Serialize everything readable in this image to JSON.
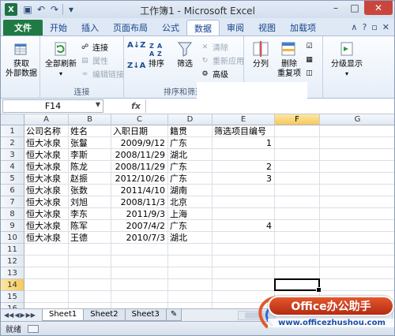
{
  "window": {
    "app_icon": "X",
    "title": "工作簿1 - Microsoft Excel",
    "min": "–",
    "max": "□",
    "close": "✕",
    "qat": [
      "save-icon",
      "undo-icon",
      "redo-icon",
      "customize-icon"
    ]
  },
  "tabs": [
    "文件",
    "开始",
    "插入",
    "页面布局",
    "公式",
    "数据",
    "审阅",
    "视图",
    "加载项"
  ],
  "active_tab": "数据",
  "ribbon": {
    "get_external": {
      "label1": "获取",
      "label2": "外部数据"
    },
    "connections": {
      "refresh_all": "全部刷新",
      "connections": "连接",
      "properties": "属性",
      "edit_links": "编辑链接",
      "group": "连接"
    },
    "sort_filter": {
      "sort_az": "A↓Z",
      "sort_za": "Z↓A",
      "sort": "排序",
      "filter": "筛选",
      "clear": "清除",
      "reapply": "重新应用",
      "advanced": "高级",
      "group": "排序和筛选"
    },
    "data_tools": {
      "text_to_columns": "分列",
      "remove_dup": "删除",
      "remove_dup2": "重复项",
      "group": "工具"
    },
    "outline": {
      "label": "分级显示"
    }
  },
  "formula_bar": {
    "name_box": "F14",
    "fx": "fx",
    "value": ""
  },
  "columns": [
    "A",
    "B",
    "C",
    "D",
    "E",
    "F",
    "G"
  ],
  "selected_column": "F",
  "rows": [
    "1",
    "2",
    "3",
    "4",
    "5",
    "6",
    "7",
    "8",
    "9",
    "10",
    "11",
    "12",
    "13",
    "14",
    "15",
    "16"
  ],
  "selected_row": "14",
  "cells": {
    "headers": [
      "公司名称",
      "姓名",
      "入职日期",
      "籍贯",
      "筛选项目编号"
    ],
    "data": [
      [
        "恒大冰泉",
        "张鬘",
        "2009/9/12",
        "广东",
        "1"
      ],
      [
        "恒大冰泉",
        "李斯",
        "2008/11/29",
        "湖北",
        ""
      ],
      [
        "恒大冰泉",
        "陈龙",
        "2008/11/29",
        "广东",
        "2"
      ],
      [
        "恒大冰泉",
        "赵振",
        "2012/10/26",
        "广东",
        "3"
      ],
      [
        "恒大冰泉",
        "张数",
        "2011/4/10",
        "湖南",
        ""
      ],
      [
        "恒大冰泉",
        "刘旭",
        "2008/11/3",
        "北京",
        ""
      ],
      [
        "恒大冰泉",
        "李东",
        "2011/9/3",
        "上海",
        ""
      ],
      [
        "恒大冰泉",
        "陈军",
        "2007/4/2",
        "广东",
        "4"
      ],
      [
        "恒大冰泉",
        "王德",
        "2010/7/3",
        "湖北",
        ""
      ]
    ]
  },
  "sheets": [
    "Sheet1",
    "Sheet2",
    "Sheet3"
  ],
  "active_sheet": "Sheet1",
  "status": "就绪",
  "watermark": {
    "brand": "Office办公助手",
    "url": "www.officezhushou.com"
  }
}
